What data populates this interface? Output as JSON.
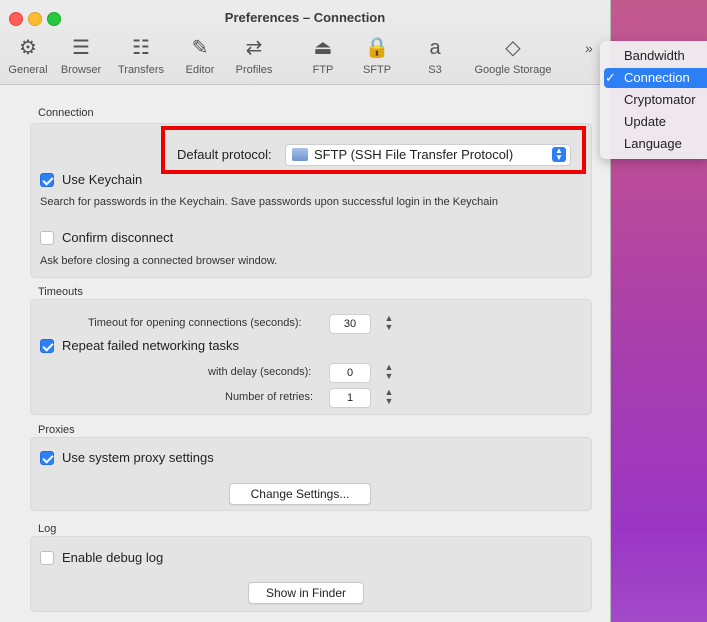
{
  "window": {
    "title": "Preferences – Connection"
  },
  "toolbar": {
    "items": [
      {
        "label": "General",
        "icon": "gear-icon",
        "glyph": "⚙"
      },
      {
        "label": "Browser",
        "icon": "list-icon",
        "glyph": "☰"
      },
      {
        "label": "Transfers",
        "icon": "transfers-icon",
        "glyph": "☷"
      },
      {
        "label": "Editor",
        "icon": "pencil-icon",
        "glyph": "✎"
      },
      {
        "label": "Profiles",
        "icon": "profiles-icon",
        "glyph": "⇄"
      },
      {
        "label": "FTP",
        "icon": "ftp-drive-icon",
        "glyph": "⏏"
      },
      {
        "label": "SFTP",
        "icon": "sftp-lock-icon",
        "glyph": "🔒"
      },
      {
        "label": "S3",
        "icon": "s3-icon",
        "glyph": "a"
      },
      {
        "label": "Google Storage",
        "icon": "google-storage-icon",
        "glyph": "◇"
      }
    ],
    "overflow_glyph": "»"
  },
  "overflow_menu": {
    "items": [
      {
        "label": "Bandwidth",
        "checked": false
      },
      {
        "label": "Connection",
        "checked": true
      },
      {
        "label": "Cryptomator",
        "checked": false
      },
      {
        "label": "Update",
        "checked": false
      },
      {
        "label": "Language",
        "checked": false
      }
    ],
    "check_glyph": "✓"
  },
  "connection": {
    "section_label": "Connection",
    "default_protocol_label": "Default protocol:",
    "default_protocol_value": "SFTP (SSH File Transfer Protocol)",
    "use_keychain": {
      "label": "Use Keychain",
      "checked": true
    },
    "use_keychain_help": "Search for passwords in the Keychain. Save passwords upon successful login in the Keychain",
    "confirm_disconnect": {
      "label": "Confirm disconnect",
      "checked": false
    },
    "confirm_disconnect_help": "Ask before closing a connected browser window."
  },
  "timeouts": {
    "section_label": "Timeouts",
    "timeout_label": "Timeout for opening connections (seconds):",
    "timeout_value": "30",
    "repeat_failed": {
      "label": "Repeat failed networking tasks",
      "checked": true
    },
    "delay_label": "with delay (seconds):",
    "delay_value": "0",
    "retries_label": "Number of retries:",
    "retries_value": "1"
  },
  "proxies": {
    "section_label": "Proxies",
    "use_system_proxy": {
      "label": "Use system proxy settings",
      "checked": true
    },
    "change_settings_label": "Change Settings..."
  },
  "log": {
    "section_label": "Log",
    "enable_debug": {
      "label": "Enable debug log",
      "checked": false
    },
    "show_in_finder_label": "Show in Finder"
  },
  "colors": {
    "accent": "#2d7ff6",
    "highlight_box": "#ee0000"
  }
}
